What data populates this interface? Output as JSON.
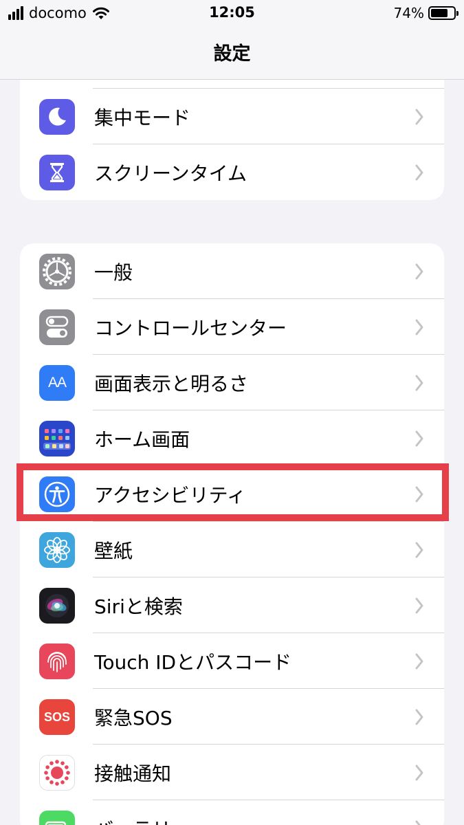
{
  "status_bar": {
    "carrier": "docomo",
    "time": "12:05",
    "battery_percent": "74%",
    "battery_level": 0.74
  },
  "nav": {
    "title": "設定"
  },
  "groups": [
    {
      "items": [
        {
          "label": "集中モード",
          "icon": "moon-icon",
          "color": "#5e5ce6"
        },
        {
          "label": "スクリーンタイム",
          "icon": "hourglass-icon",
          "color": "#5e5ce6"
        }
      ]
    },
    {
      "items": [
        {
          "label": "一般",
          "icon": "gear-icon",
          "color": "#8e8e93"
        },
        {
          "label": "コントロールセンター",
          "icon": "toggles-icon",
          "color": "#8e8e93"
        },
        {
          "label": "画面表示と明るさ",
          "icon": "text-size-icon",
          "color": "#2f7cf6",
          "icon_text": "AA"
        },
        {
          "label": "ホーム画面",
          "icon": "home-grid-icon",
          "color": "#2a47c9"
        },
        {
          "label": "アクセシビリティ",
          "icon": "accessibility-icon",
          "color": "#2f7cf6",
          "highlighted": true
        },
        {
          "label": "壁紙",
          "icon": "flower-icon",
          "color": "#3ea6dc"
        },
        {
          "label": "Siriと検索",
          "icon": "siri-icon",
          "color": "#1a1a1f"
        },
        {
          "label": "Touch IDとパスコード",
          "icon": "fingerprint-icon",
          "color": "#e8465a"
        },
        {
          "label": "緊急SOS",
          "icon": "sos-icon",
          "color": "#e8463c",
          "icon_text": "SOS"
        },
        {
          "label": "接触通知",
          "icon": "exposure-icon",
          "color": "#ffffff"
        },
        {
          "label": "バッテリー",
          "icon": "battery-icon",
          "color": "#4cd964"
        }
      ]
    }
  ],
  "highlight_color": "#e5404a"
}
